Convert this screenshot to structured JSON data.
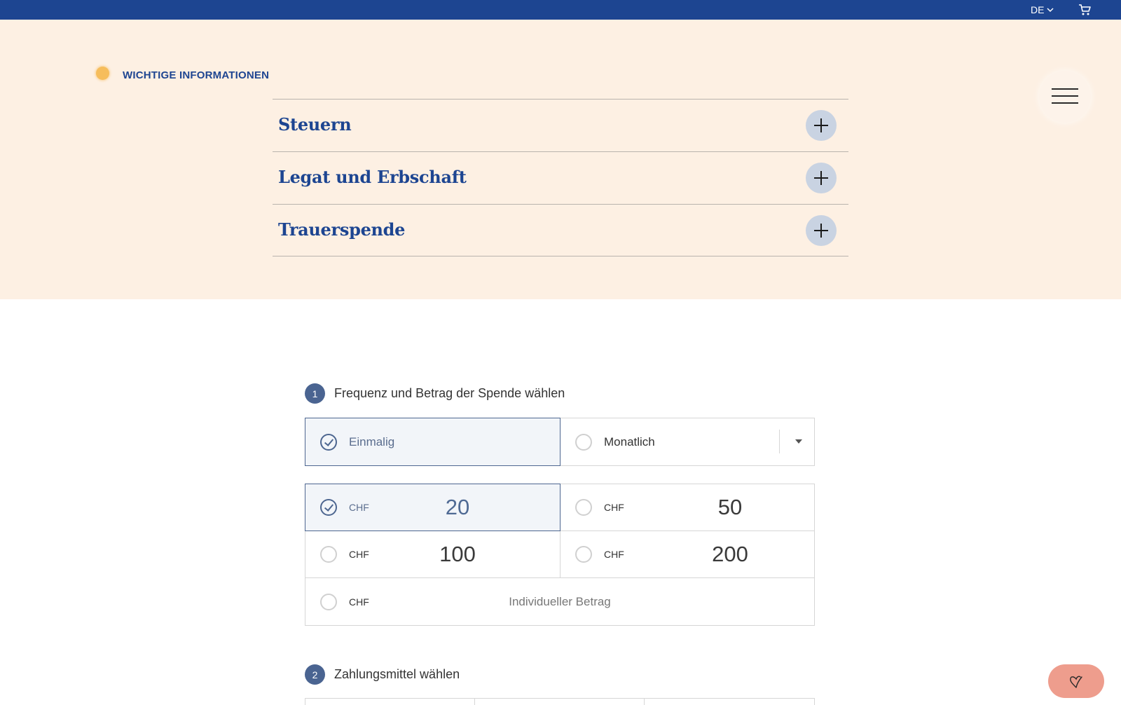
{
  "topbar": {
    "language": "DE",
    "cart_icon": "shopping-cart-icon",
    "background": "#1d4591"
  },
  "info": {
    "label": "WICHTIGE INFORMATIONEN"
  },
  "accordion": {
    "items": [
      {
        "title": "Steuern"
      },
      {
        "title": "Legat und Erbschaft"
      },
      {
        "title": "Trauerspende"
      }
    ]
  },
  "step1": {
    "number": "1",
    "label": "Frequenz und Betrag der Spende wählen",
    "frequency": [
      {
        "label": "Einmalig",
        "selected": true
      },
      {
        "label": "Monatlich",
        "selected": false
      }
    ],
    "currency": "CHF",
    "amounts": [
      {
        "value": "20",
        "selected": true
      },
      {
        "value": "50",
        "selected": false
      },
      {
        "value": "100",
        "selected": false
      },
      {
        "value": "200",
        "selected": false
      }
    ],
    "custom_placeholder": "Individueller Betrag"
  },
  "step2": {
    "number": "2",
    "label": "Zahlungsmittel wählen"
  },
  "colors": {
    "brand_blue": "#1d4591",
    "cream": "#fdf0e3",
    "step_badge": "#4a6491",
    "fab": "#ee9d8d",
    "info_dot": "#f6bd5c"
  }
}
